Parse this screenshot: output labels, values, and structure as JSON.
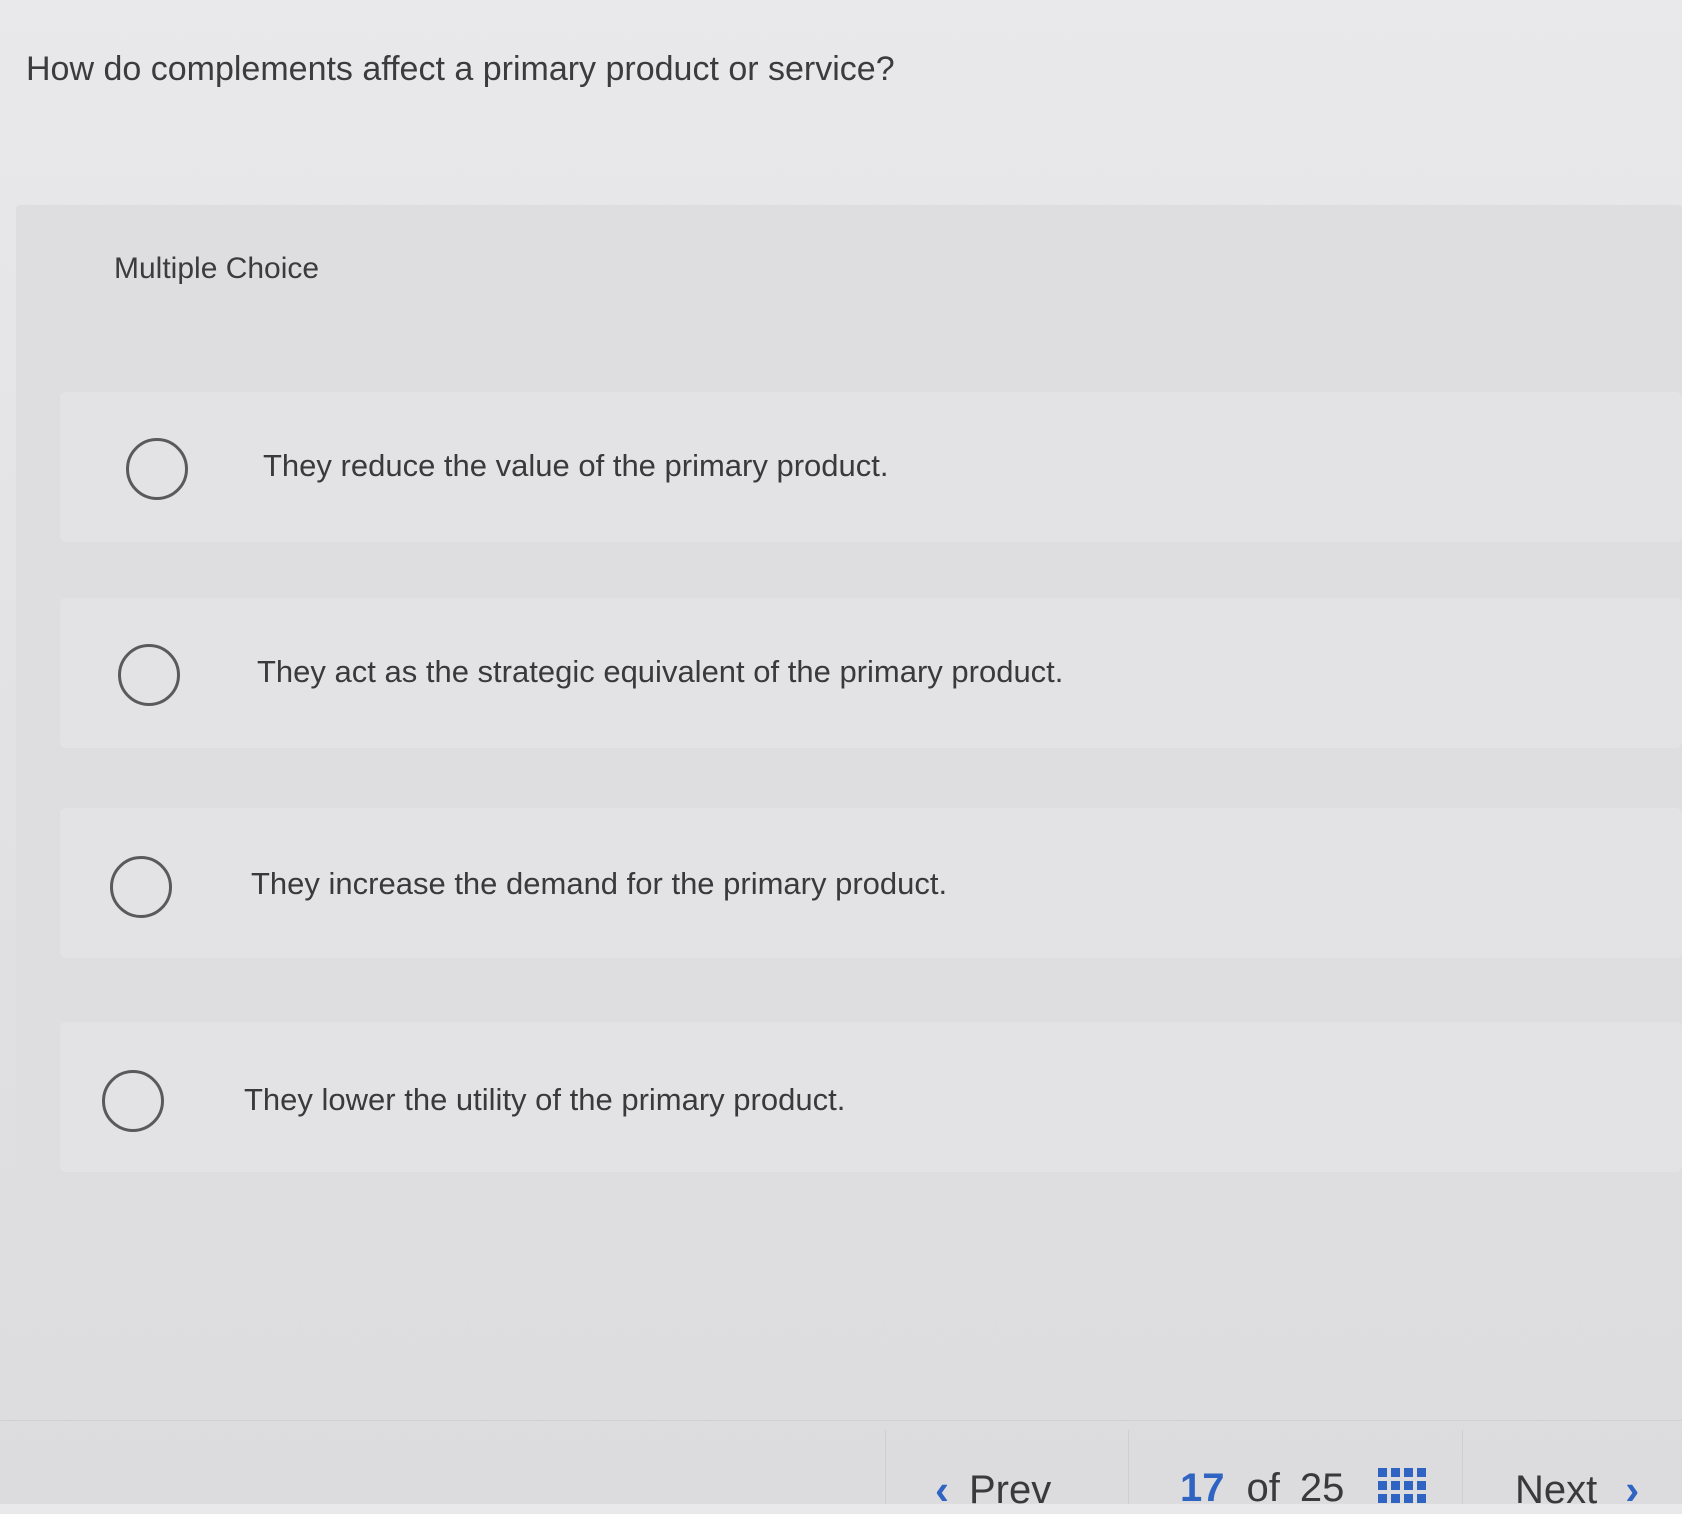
{
  "question": {
    "text": "How do complements affect a primary product or service?"
  },
  "multiple_choice": {
    "label": "Multiple Choice",
    "options": [
      {
        "text": "They reduce the value of the primary product."
      },
      {
        "text": "They act as the strategic equivalent of the primary product."
      },
      {
        "text": "They increase the demand for the primary product."
      },
      {
        "text": "They lower the utility of the primary product."
      }
    ]
  },
  "navigation": {
    "prev_label": "Prev",
    "next_label": "Next",
    "current_page": "17",
    "of_label": "of",
    "total_pages": "25"
  },
  "colors": {
    "accent": "#2f64c2",
    "text": "#3a3a3c"
  },
  "icons": {
    "prev": "chevron-left-icon",
    "next": "chevron-right-icon",
    "question_map": "grid-icon"
  }
}
